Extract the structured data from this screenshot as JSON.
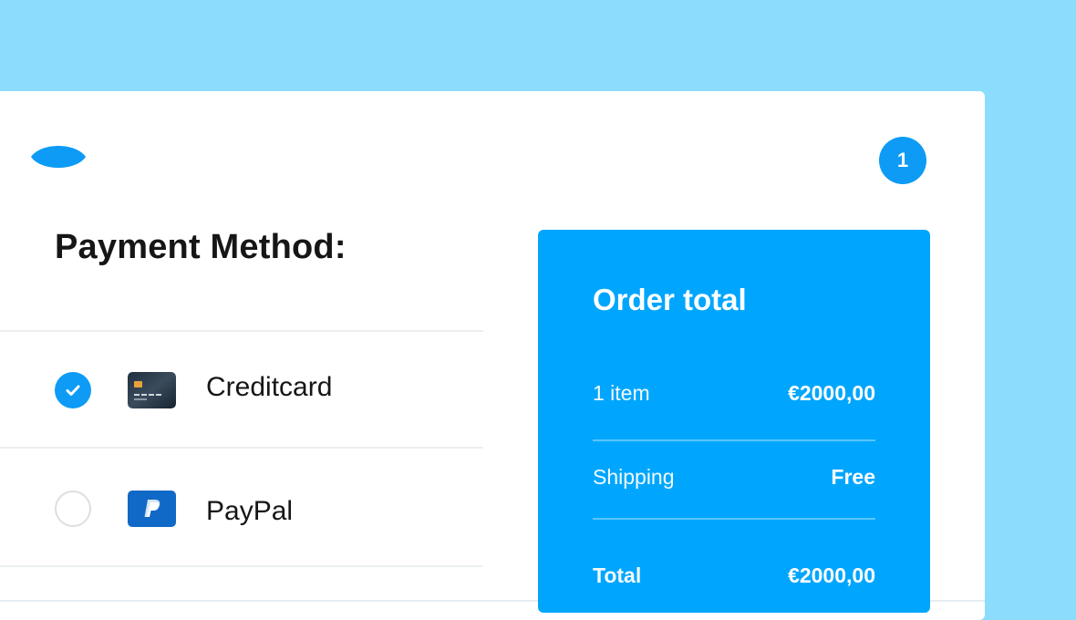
{
  "colors": {
    "background": "#8bdcfd",
    "accent": "#0d9bf5",
    "summary_panel": "#00a6fd",
    "card": "#ffffff"
  },
  "header": {
    "logo_icon": "leaf-eye-logo",
    "cart_count": "1"
  },
  "page": {
    "title": "Payment Method:"
  },
  "payment_methods": [
    {
      "label": "Creditcard",
      "icon": "credit-card-icon",
      "selected": true
    },
    {
      "label": "PayPal",
      "icon": "paypal-icon",
      "selected": false
    }
  ],
  "order_summary": {
    "title": "Order total",
    "items_label": "1 item",
    "items_value": "€2000,00",
    "shipping_label": "Shipping",
    "shipping_value": "Free",
    "total_label": "Total",
    "total_value": "€2000,00"
  }
}
